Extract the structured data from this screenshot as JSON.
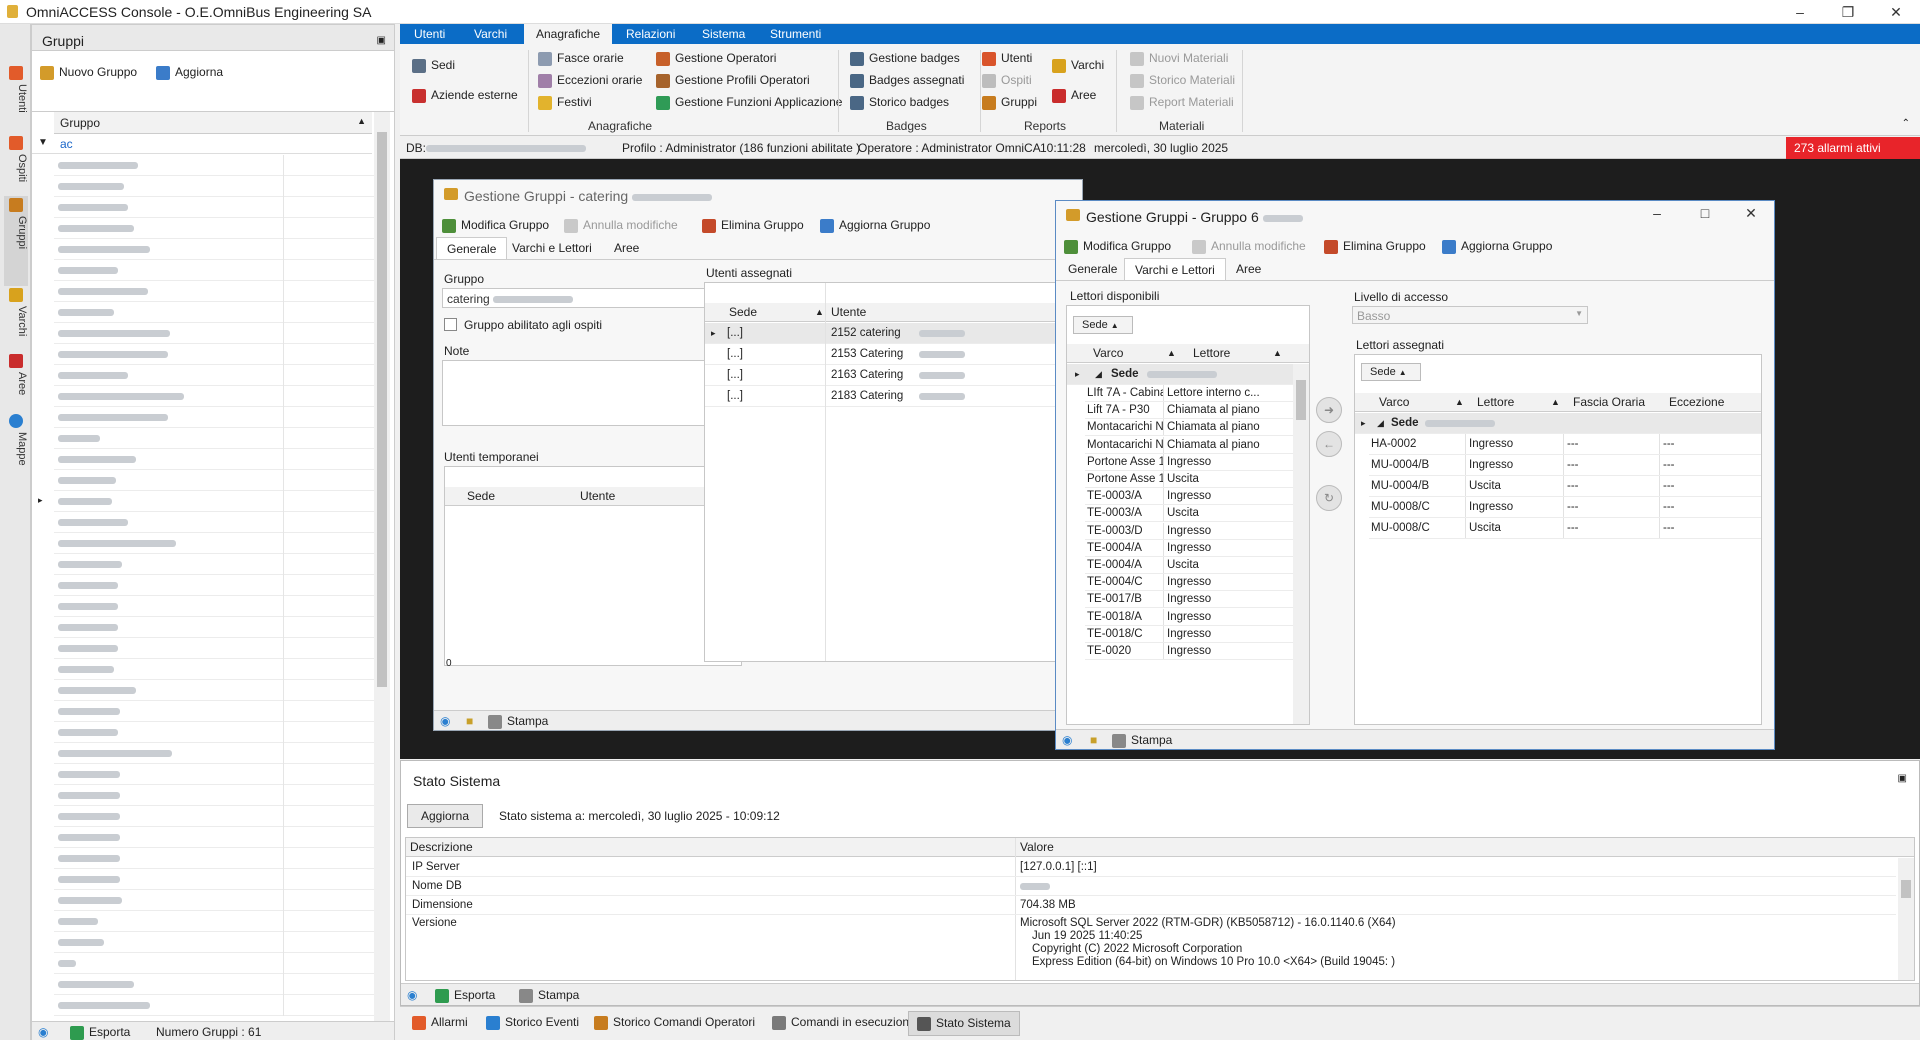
{
  "app": {
    "title": "OmniACCESS Console - O.E.OmniBus Engineering SA"
  },
  "colors": {
    "ribbon_blue": "#0b6cc6",
    "alarm_red": "#e8242a",
    "mdi_bg": "#1d1d1d"
  },
  "left_strip": [
    "Utenti",
    "Ospiti",
    "Gruppi",
    "Varchi",
    "Aree",
    "Mappe"
  ],
  "left_panel": {
    "title": "Gruppi",
    "btn_new": "Nuovo Gruppo",
    "btn_refresh": "Aggiorna",
    "col_group": "Gruppo",
    "filter_value": "ac",
    "footer_export": "Esporta",
    "footer_count": "Numero Gruppi : 61"
  },
  "ribbon": {
    "tabs": [
      "Utenti",
      "Varchi",
      "Anagrafiche",
      "Relazioni",
      "Sistema",
      "Strumenti"
    ],
    "active_tab": "Anagrafiche",
    "items": {
      "sedi": "Sedi",
      "aziende": "Aziende esterne",
      "fasce": "Fasce orarie",
      "eccezioni": "Eccezioni orarie",
      "festivi": "Festivi",
      "gest_operatori": "Gestione Operatori",
      "gest_profili": "Gestione Profili Operatori",
      "gest_funzioni": "Gestione Funzioni Applicazione",
      "gest_badges": "Gestione badges",
      "badges_assegnati": "Badges assegnati",
      "storico_badges": "Storico badges",
      "utenti": "Utenti",
      "ospiti": "Ospiti",
      "gruppi": "Gruppi",
      "varchi": "Varchi",
      "aree": "Aree",
      "nuovi_materiali": "Nuovi Materiali",
      "storico_materiali": "Storico Materiali",
      "report_materiali": "Report Materiali"
    },
    "groups": [
      "Anagrafiche",
      "Badges",
      "Reports",
      "Materiali"
    ]
  },
  "status_line": {
    "db_label": "DB:",
    "profile": "Profilo : Administrator (186  funzioni abilitate )",
    "operator": "Operatore : Administrator OmniCA",
    "time": "10:11:28",
    "date": "mercoledì, 30 luglio 2025",
    "alarms": "273  allarmi attivi"
  },
  "win1": {
    "title": "Gestione Gruppi  - catering",
    "btn_modify": "Modifica Gruppo",
    "btn_cancel": "Annulla modifiche",
    "btn_delete": "Elimina Gruppo",
    "btn_refresh": "Aggiorna Gruppo",
    "tabs": [
      "Generale",
      "Varchi e Lettori",
      "Aree"
    ],
    "lbl_group": "Gruppo",
    "group_value": "catering",
    "chk_guests": "Gruppo abilitato agli ospiti",
    "lbl_notes": "Note",
    "lbl_temp": "Utenti  temporanei",
    "temp_col_sede": "Sede",
    "temp_col_user": "Utente",
    "temp_count": "0",
    "lbl_assigned": "Utenti assegnati",
    "as_col_sede": "Sede",
    "as_col_user": "Utente",
    "assigned": [
      {
        "sede": "[...]",
        "user": "2152 catering"
      },
      {
        "sede": "[...]",
        "user": "2153 Catering"
      },
      {
        "sede": "[...]",
        "user": "2163 Catering"
      },
      {
        "sede": "[...]",
        "user": "2183 Catering"
      }
    ],
    "footer_print": "Stampa"
  },
  "win2": {
    "title": "Gestione Gruppi  - Gruppo 6",
    "btn_modify": "Modifica Gruppo",
    "btn_cancel": "Annulla modifiche",
    "btn_delete": "Elimina Gruppo",
    "btn_refresh": "Aggiorna Gruppo",
    "tabs": [
      "Generale",
      "Varchi e Lettori",
      "Aree"
    ],
    "lbl_available": "Lettori disponibili",
    "group_chip": "Sede",
    "col_varco": "Varco",
    "col_lettore": "Lettore",
    "group_row": "Sede",
    "available": [
      {
        "varco": "LIft 7A - Cabina ...",
        "lettore": "Lettore interno c..."
      },
      {
        "varco": "Lift 7A - P30",
        "lettore": "Chiamata al piano"
      },
      {
        "varco": "Montacarichi N°1...",
        "lettore": "Chiamata al piano"
      },
      {
        "varco": "Montacarichi N°1...",
        "lettore": "Chiamata al piano"
      },
      {
        "varco": "Portone Asse 18",
        "lettore": "Ingresso"
      },
      {
        "varco": "Portone Asse 18",
        "lettore": "Uscita"
      },
      {
        "varco": "TE-0003/A",
        "lettore": "Ingresso"
      },
      {
        "varco": "TE-0003/A",
        "lettore": "Uscita"
      },
      {
        "varco": "TE-0003/D",
        "lettore": "Ingresso"
      },
      {
        "varco": "TE-0004/A",
        "lettore": "Ingresso"
      },
      {
        "varco": "TE-0004/A",
        "lettore": "Uscita"
      },
      {
        "varco": "TE-0004/C",
        "lettore": "Ingresso"
      },
      {
        "varco": "TE-0017/B",
        "lettore": "Ingresso"
      },
      {
        "varco": "TE-0018/A",
        "lettore": "Ingresso"
      },
      {
        "varco": "TE-0018/C",
        "lettore": "Ingresso"
      },
      {
        "varco": "TE-0020",
        "lettore": "Ingresso"
      }
    ],
    "lbl_access": "Livello di accesso",
    "access_value": "Basso",
    "lbl_assigned": "Lettori assegnati",
    "col_fascia": "Fascia Oraria",
    "col_eccezione": "Eccezione",
    "assigned": [
      {
        "varco": "HA-0002",
        "lettore": "Ingresso",
        "fascia": "---",
        "eccezione": "---"
      },
      {
        "varco": "MU-0004/B",
        "lettore": "Ingresso",
        "fascia": "---",
        "eccezione": "---"
      },
      {
        "varco": "MU-0004/B",
        "lettore": "Uscita",
        "fascia": "---",
        "eccezione": "---"
      },
      {
        "varco": "MU-0008/C",
        "lettore": "Ingresso",
        "fascia": "---",
        "eccezione": "---"
      },
      {
        "varco": "MU-0008/C",
        "lettore": "Uscita",
        "fascia": "---",
        "eccezione": "---"
      }
    ],
    "footer_print": "Stampa"
  },
  "stato": {
    "title": "Stato Sistema",
    "btn_refresh": "Aggiorna",
    "stamp": "Stato sistema a:  mercoledì, 30 luglio 2025 - 10:09:12",
    "col_desc": "Descrizione",
    "col_val": "Valore",
    "rows": [
      {
        "desc": "IP Server",
        "val": "[127.0.0.1] [::1]"
      },
      {
        "desc": "Nome DB",
        "val": ""
      },
      {
        "desc": "Dimensione",
        "val": "704.38 MB"
      }
    ],
    "version_label": "Versione",
    "version_lines": [
      "Microsoft SQL Server 2022 (RTM-GDR) (KB5058712) - 16.0.1140.6 (X64)",
      "Jun 19 2025 11:40:25",
      "Copyright (C) 2022 Microsoft Corporation",
      "Express Edition (64-bit) on Windows 10 Pro 10.0 <X64> (Build 19045: )"
    ],
    "footer_export": "Esporta",
    "footer_print": "Stampa"
  },
  "bottom_tabs": [
    "Allarmi",
    "Storico Eventi",
    "Storico Comandi Operatori",
    "Comandi in esecuzione",
    "Stato Sistema"
  ]
}
